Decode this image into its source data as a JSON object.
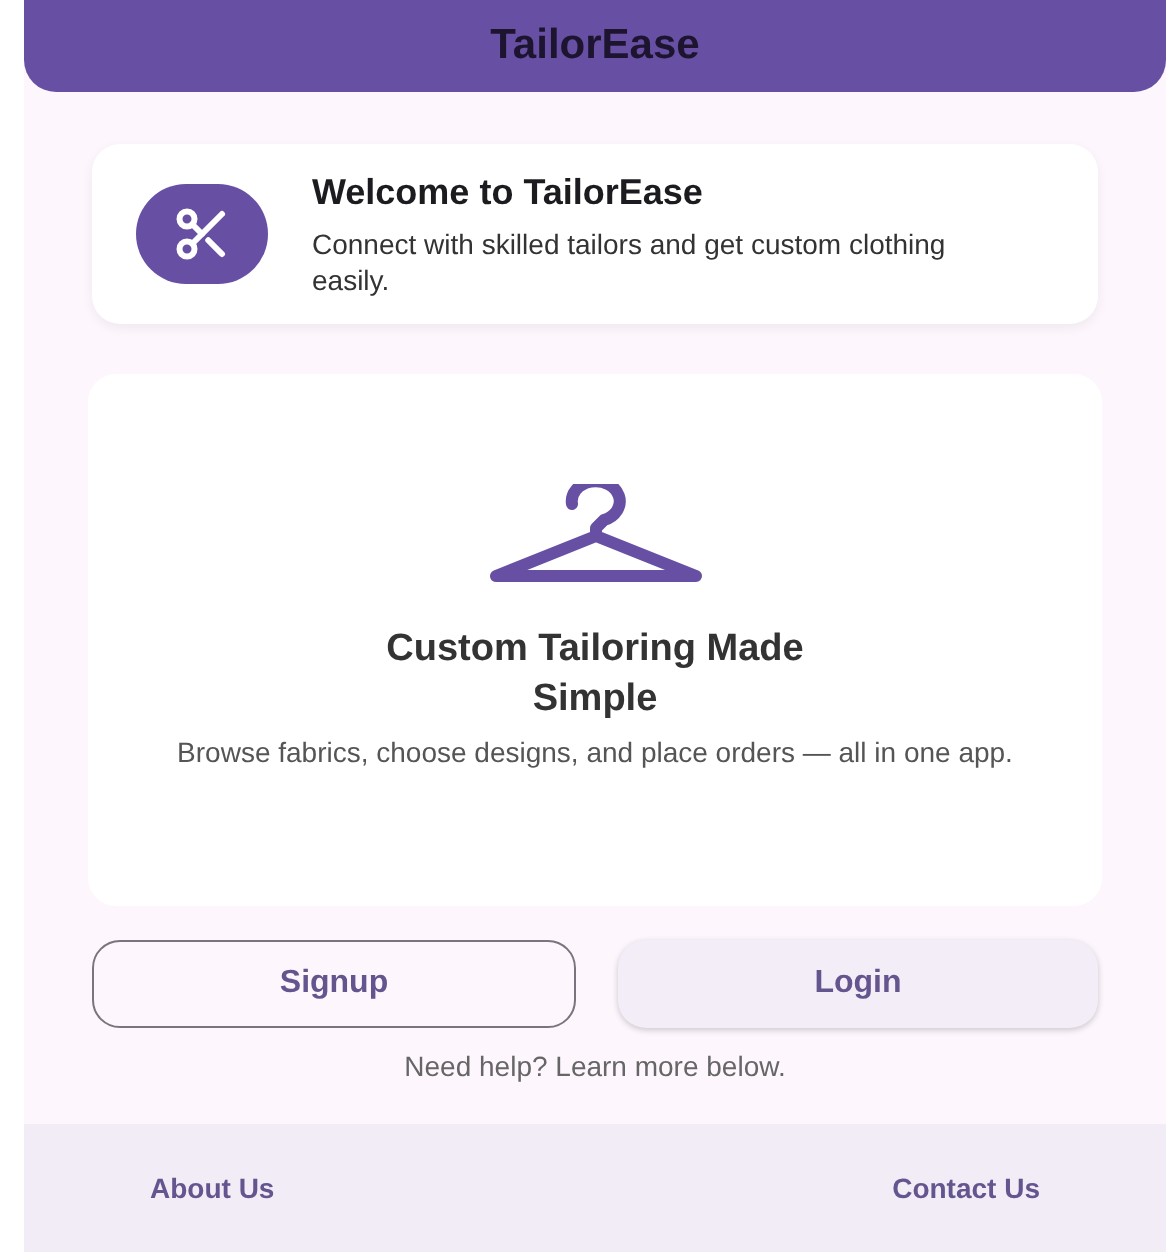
{
  "app_bar": {
    "title": "TailorEase"
  },
  "welcome_card": {
    "title": "Welcome to TailorEase",
    "text": "Connect with skilled tailors and get custom clothing easily."
  },
  "hero_card": {
    "title": "Custom Tailoring Made Simple",
    "text": "Browse fabrics, choose designs, and place orders — all in one app."
  },
  "buttons": [
    {
      "label": "Signup",
      "kind": "outlined"
    },
    {
      "label": "Login",
      "kind": "filled"
    }
  ],
  "help_text": "Need help? Learn more below.",
  "footer_links": [
    "About Us",
    "Contact Us"
  ]
}
